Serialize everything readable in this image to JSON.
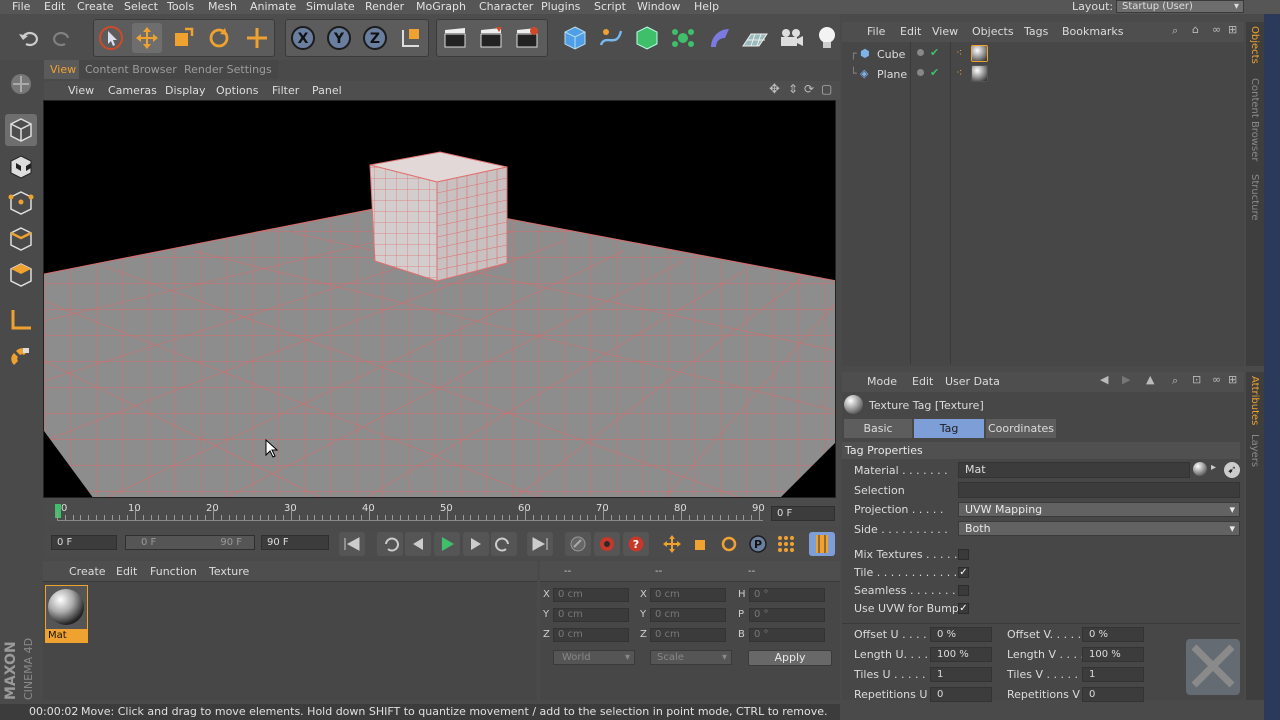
{
  "menubar": {
    "items": [
      "File",
      "Edit",
      "Create",
      "Select",
      "Tools",
      "Mesh",
      "Animate",
      "Simulate",
      "Render",
      "MoGraph",
      "Character",
      "Plugins",
      "Script",
      "Window",
      "Help"
    ],
    "layout_label": "Layout:",
    "layout_value": "Startup (User)"
  },
  "right_tabs": {
    "objects": "Objects",
    "content_browser": "Content Browser",
    "structure": "Structure",
    "attributes": "Attributes",
    "layers": "Layers"
  },
  "viewport_tabs": [
    "View",
    "Content Browser",
    "Render Settings"
  ],
  "viewport_menu": [
    "View",
    "Cameras",
    "Display",
    "Options",
    "Filter",
    "Panel"
  ],
  "timeline": {
    "labels": [
      "0",
      "10",
      "20",
      "30",
      "40",
      "50",
      "60",
      "70",
      "80",
      "90"
    ],
    "frame_field": "0 F",
    "start": "0 F",
    "range_start": "0 F",
    "range_end": "90 F",
    "end": "90 F"
  },
  "material_manager": {
    "menu": [
      "Create",
      "Edit",
      "Function",
      "Texture"
    ],
    "material_name": "Mat"
  },
  "coordinates": {
    "dashes": [
      "--",
      "--",
      "--"
    ],
    "rows": [
      {
        "a": "X",
        "av": "0 cm",
        "b": "X",
        "bv": "0 cm",
        "c": "H",
        "cv": "0 °"
      },
      {
        "a": "Y",
        "av": "0 cm",
        "b": "Y",
        "bv": "0 cm",
        "c": "P",
        "cv": "0 °"
      },
      {
        "a": "Z",
        "av": "0 cm",
        "b": "Z",
        "bv": "0 cm",
        "c": "B",
        "cv": "0 °"
      }
    ],
    "world": "World",
    "scale": "Scale",
    "apply": "Apply"
  },
  "status": {
    "time": "00:00:02",
    "message": "Move: Click and drag to move elements. Hold down SHIFT to quantize movement / add to the selection in point mode, CTRL to remove."
  },
  "object_manager": {
    "menu": [
      "File",
      "Edit",
      "View",
      "Objects",
      "Tags",
      "Bookmarks"
    ],
    "objects": [
      {
        "name": "Cube",
        "color": "#7fb3e8"
      },
      {
        "name": "Plane",
        "color": "#7fb3e8"
      }
    ]
  },
  "attribute_manager": {
    "menu": [
      "Mode",
      "Edit",
      "User Data"
    ],
    "title": "Texture Tag [Texture]",
    "tabs": [
      "Basic",
      "Tag",
      "Coordinates"
    ],
    "active_tab": "Tag",
    "section": "Tag Properties",
    "material_label": "Material . . . . . . .",
    "material_value": "Mat",
    "selection_label": "Selection",
    "projection_label": "Projection . . . . .",
    "projection_value": "UVW Mapping",
    "side_label": "Side . . . . . . . . . .",
    "side_value": "Both",
    "mix_label": "Mix Textures . . . . . .",
    "tile_label": "Tile . . . . . . . . . . . . .",
    "seamless_label": "Seamless . . . . . . .",
    "uvwbump_label": "Use UVW for Bump",
    "mix_checked": false,
    "tile_checked": true,
    "seamless_checked": false,
    "uvwbump_checked": true,
    "offset_u_label": "Offset U . . . . .",
    "offset_u": "0 %",
    "offset_v_label": "Offset V. . . . .",
    "offset_v": "0 %",
    "length_u_label": "Length U. . . . .",
    "length_u": "100 %",
    "length_v_label": "Length V . . . .",
    "length_v": "100 %",
    "tiles_u_label": "Tiles U . . . . . .",
    "tiles_u": "1",
    "tiles_v_label": "Tiles V . . . . . .",
    "tiles_v": "1",
    "rep_u_label": "Repetitions U",
    "rep_u": "0",
    "rep_v_label": "Repetitions V",
    "rep_v": "0"
  },
  "brand": {
    "maxon": "MAXON",
    "cinema": "CINEMA 4D"
  },
  "colors": {
    "accent": "#f0a230",
    "active_tab": "#7d9ed6",
    "grid_line": "#d96a6a"
  }
}
